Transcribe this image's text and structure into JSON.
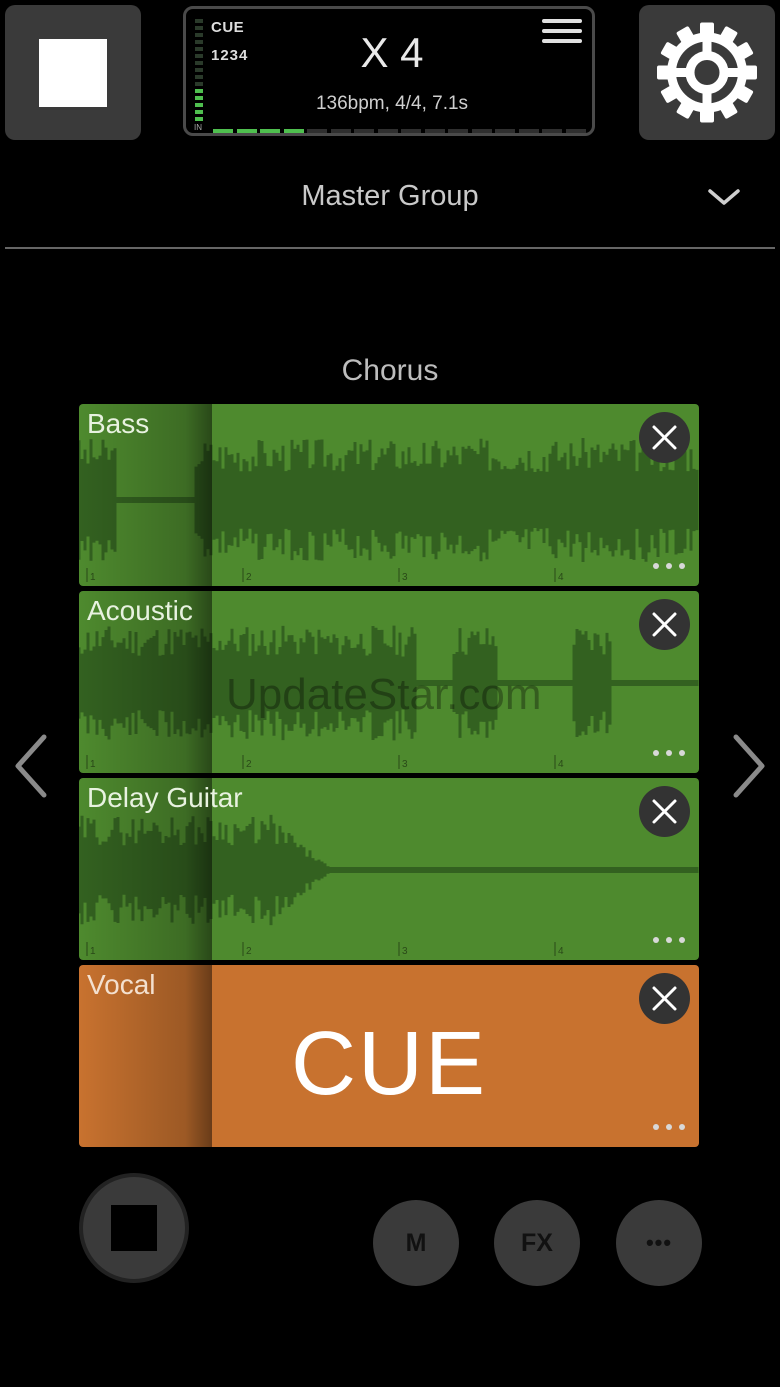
{
  "header": {
    "display": {
      "cue_label": "CUE",
      "beat_label": "1234",
      "meter_label": "IN",
      "loop_count": "X 4",
      "info": "136bpm, 4/4, 7.1s",
      "progress_fraction": 0.25
    }
  },
  "group": {
    "title": "Master Group"
  },
  "section": {
    "title": "Chorus"
  },
  "tracks": [
    {
      "name": "Bass",
      "state": "playing",
      "color": "#4e8a2e"
    },
    {
      "name": "Acoustic",
      "state": "playing",
      "color": "#4e8a2e"
    },
    {
      "name": "Delay Guitar",
      "state": "playing",
      "color": "#4e8a2e"
    },
    {
      "name": "Vocal",
      "state": "cue",
      "color": "#c8722f",
      "overlay": "CUE"
    }
  ],
  "ruler_marks": [
    "1",
    "2",
    "3",
    "4"
  ],
  "watermark": "UpdateStar.com",
  "bottom": {
    "m_label": "M",
    "fx_label": "FX",
    "more_label": "•••"
  },
  "icons": {
    "stop": "stop-icon",
    "settings": "gear-icon",
    "menu": "hamburger-icon",
    "dropdown": "chevron-down-icon",
    "close": "close-icon",
    "more": "more-dots-icon",
    "prev": "chevron-left-icon",
    "next": "chevron-right-icon"
  }
}
